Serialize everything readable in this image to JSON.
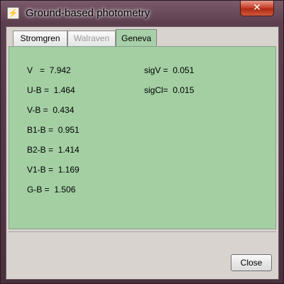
{
  "window": {
    "title": "Ground-based photometry",
    "close_glyph": "✕"
  },
  "tabs": [
    {
      "label": "Stromgren",
      "state": "normal"
    },
    {
      "label": "Walraven",
      "state": "disabled"
    },
    {
      "label": "Geneva",
      "state": "selected"
    }
  ],
  "panel": {
    "background": "#a3cfa3",
    "left_column": [
      {
        "text": "V   =  7.942"
      },
      {
        "text": "U-B =  1.464"
      },
      {
        "text": "V-B =  0.434"
      },
      {
        "text": "B1-B =  0.951"
      },
      {
        "text": "B2-B =  1.414"
      },
      {
        "text": "V1-B =  1.169"
      },
      {
        "text": "G-B =  1.506"
      }
    ],
    "right_column": [
      {
        "text": "sigV =  0.051"
      },
      {
        "text": "sigCl=  0.015"
      }
    ]
  },
  "footer": {
    "close_label": "Close"
  }
}
